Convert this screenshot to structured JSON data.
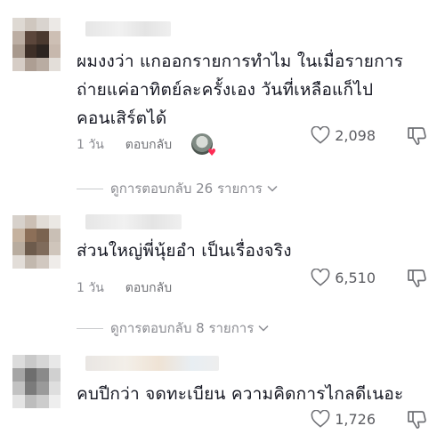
{
  "comments": [
    {
      "text_lines": [
        "ผมงงว่า แกออกรายการทำไม ในเมื่อรายการ",
        "ถ่ายแค่อาทิตย์ละครั้งเอง วันที่เหลือแก็ไป",
        "คอนเสิร์ตได้"
      ],
      "time": "1 วัน",
      "reply_label": "ตอบกลับ",
      "likes": "2,098",
      "view_replies": "ดูการตอบกลับ 26 รายการ",
      "avatar_colors": [
        "#ded9d3",
        "#cfc7bf",
        "#d9d4cf",
        "#ece9e6",
        "#bcaea3",
        "#5b463b",
        "#4a392f",
        "#cdbfb4",
        "#a8998d",
        "#3e2f27",
        "#2c2420",
        "#c7b8ad",
        "#d6cdc6",
        "#ad9e93",
        "#b9aca2",
        "#e3ded9"
      ]
    },
    {
      "text_lines": [
        "ส่วนใหญ่พี่นุ้ยอำ เป็นเรื่องจริง"
      ],
      "time": "1 วัน",
      "reply_label": "ตอบกลับ",
      "likes": "6,510",
      "view_replies": "ดูการตอบกลับ 8 รายการ",
      "avatar_colors": [
        "#d7d1cb",
        "#cbbfb4",
        "#e1dcd6",
        "#ebe8e4",
        "#c5b29f",
        "#8c6f58",
        "#7a6350",
        "#c9bfb5",
        "#b8ac9f",
        "#6d5b4c",
        "#7f6b5b",
        "#cfc5bb",
        "#e2ddd8",
        "#c2b8ae",
        "#d1c8c0",
        "#efece9"
      ]
    },
    {
      "text_lines": [
        "คบปีกว่า จดทะเบียน ความคิดการไกลดีเนอะ"
      ],
      "likes": "1,726",
      "avatar_colors": [
        "#dcdcdc",
        "#c9c9c9",
        "#d6d6d6",
        "#e8e8e8",
        "#a5a5a5",
        "#6e6e6e",
        "#8a8a8a",
        "#d0d0d0",
        "#c2c2c2",
        "#7b7b7b",
        "#9a9a9a",
        "#dedede",
        "#e4e4e4",
        "#bdbdbd",
        "#cccccc",
        "#eeeeee"
      ]
    }
  ],
  "colors": {
    "heart": "#fe2c55",
    "muted": "#8a8b91",
    "text": "#161823"
  }
}
